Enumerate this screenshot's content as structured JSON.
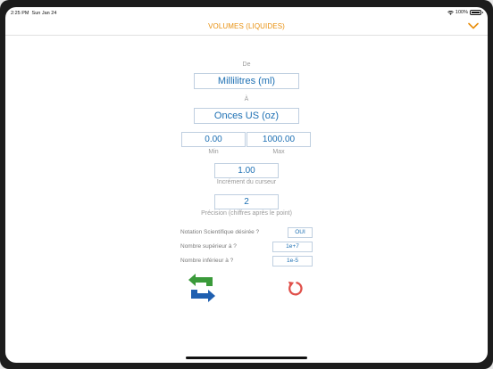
{
  "status": {
    "time": "2:25 PM",
    "date": "Sun Jan 24",
    "battery": "100%",
    "battery_level": 1.0
  },
  "nav": {
    "title": "VOLUMES (LIQUIDES)"
  },
  "conversion": {
    "from_label": "De",
    "from_unit": "Millilitres (ml)",
    "to_label": "À",
    "to_unit": "Onces US (oz)"
  },
  "range": {
    "min_value": "0.00",
    "max_value": "1000.00",
    "min_label": "Min",
    "max_label": "Max"
  },
  "slider_increment": {
    "value": "1.00",
    "label": "Incrément du curseur"
  },
  "precision": {
    "value": "2",
    "label": "Précision (chiffres après le point)"
  },
  "options": {
    "scientific_label": "Notation Scientifique désirée ?",
    "scientific_value": "OUI",
    "upper_label": "Nombre supérieur à ?",
    "upper_value": "1e+7",
    "lower_label": "Nombre inférieur à ?",
    "lower_value": "1e-5"
  },
  "icons": {
    "swap": "swap-arrows-icon",
    "reset": "reset-icon",
    "wifi": "wifi-icon",
    "chevron": "chevron-down-icon"
  },
  "colors": {
    "accent": "#e8900f",
    "value_text": "#1c6fb3",
    "swap_green": "#3a9a3a",
    "swap_blue": "#1f5fb0",
    "reset_red": "#e0504a"
  }
}
